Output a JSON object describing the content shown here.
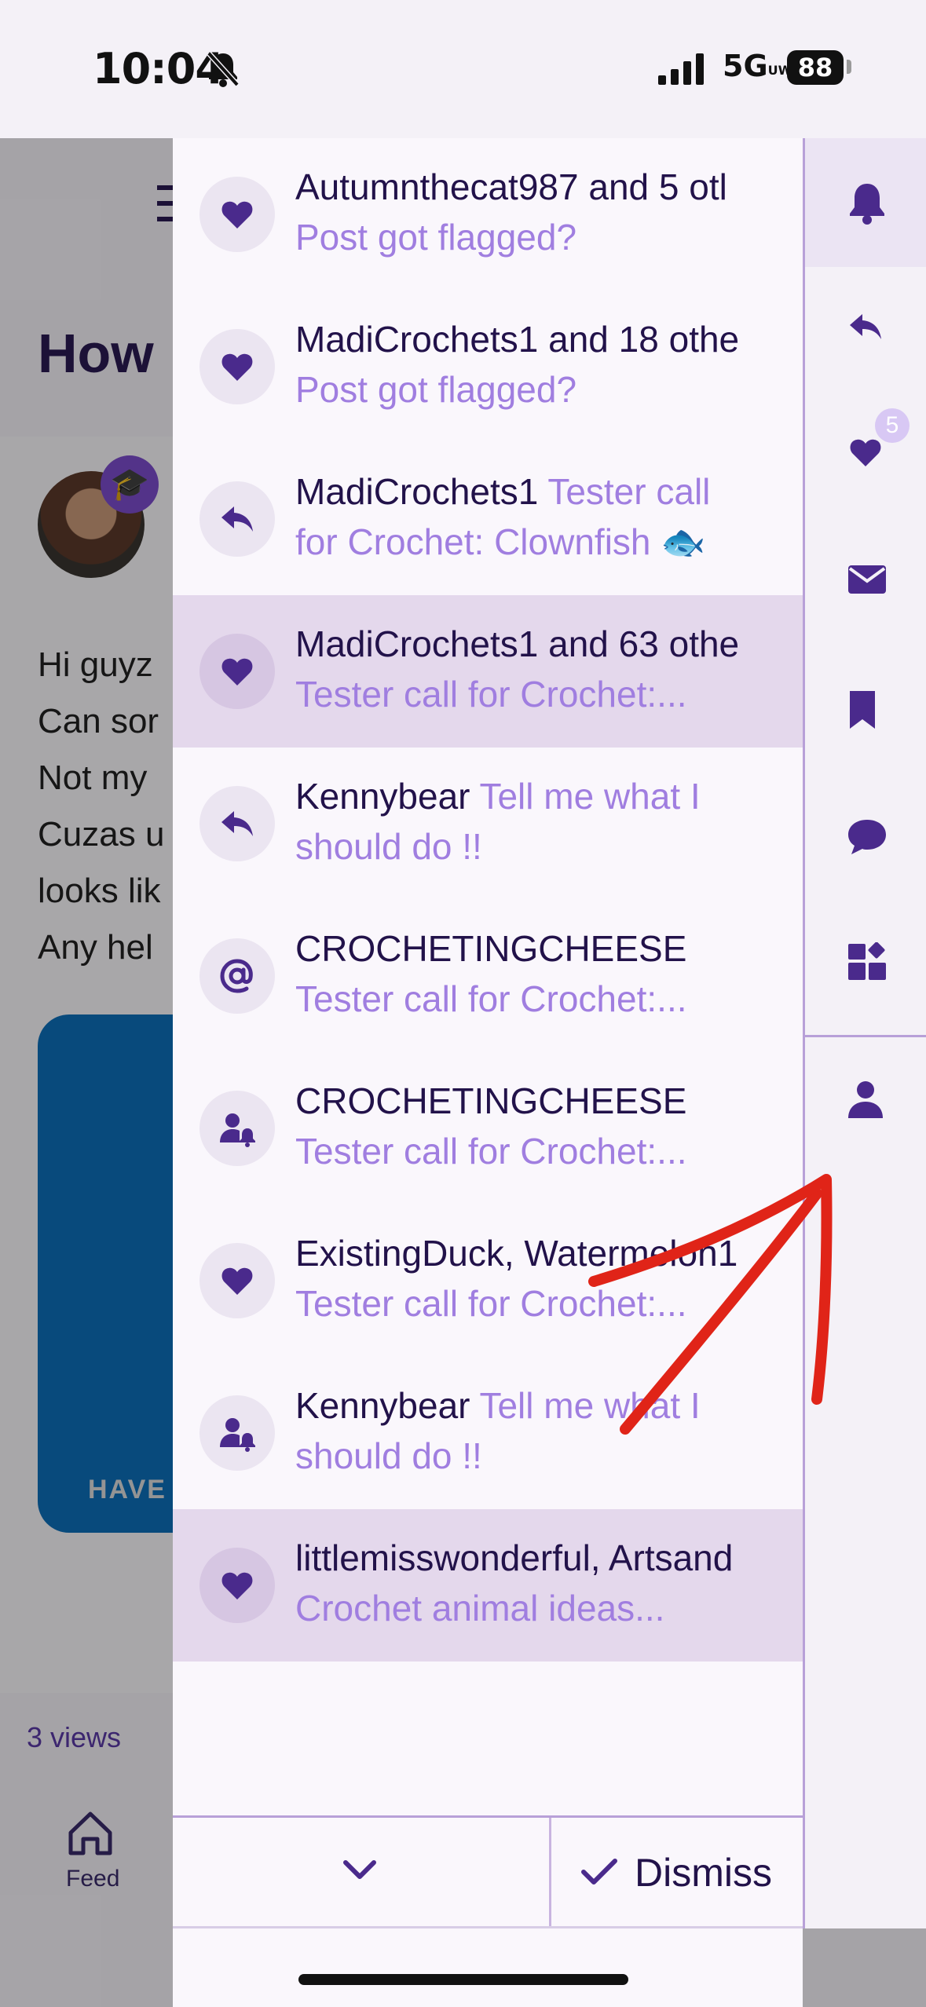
{
  "status_bar": {
    "time": "10:04",
    "network": "5G",
    "network_super": "UW",
    "battery": "88"
  },
  "background": {
    "title": "How",
    "body_lines": [
      "Hi guyz",
      "Can sor",
      "Not my",
      "Cuzas u",
      "looks lik",
      "Any hel"
    ],
    "image_text": "HAVE",
    "views": "3 views",
    "feed_label": "Feed"
  },
  "notifications": [
    {
      "icon": "heart-icon",
      "actor": "Autumnthecat987 and 5 otl",
      "subject": "",
      "subtitle": "Post got flagged?",
      "highlighted": false
    },
    {
      "icon": "heart-icon",
      "actor": "MadiCrochets1 and 18 othe",
      "subject": "",
      "subtitle": "Post got flagged?",
      "highlighted": false
    },
    {
      "icon": "reply-icon",
      "actor": "MadiCrochets1",
      "subject": "Tester call",
      "subtitle": "for Crochet: Clownfish 🐟",
      "highlighted": false
    },
    {
      "icon": "heart-icon",
      "actor": "MadiCrochets1 and 63 othe",
      "subject": "",
      "subtitle": "Tester call for Crochet:...",
      "highlighted": true
    },
    {
      "icon": "reply-icon",
      "actor": "Kennybear",
      "subject": "Tell me what I",
      "subtitle": "should do !!",
      "highlighted": false
    },
    {
      "icon": "at-icon",
      "actor": "CROCHETINGCHEESE",
      "subject": "",
      "subtitle": "Tester call for Crochet:...",
      "highlighted": false
    },
    {
      "icon": "user-bell-icon",
      "actor": "CROCHETINGCHEESE",
      "subject": "",
      "subtitle": "Tester call for Crochet:...",
      "highlighted": false
    },
    {
      "icon": "heart-icon",
      "actor": "ExistingDuck, Watermelon1",
      "subject": "",
      "subtitle": "Tester call for Crochet:...",
      "highlighted": false
    },
    {
      "icon": "user-bell-icon",
      "actor": "Kennybear",
      "subject": "Tell me what I",
      "subtitle": "should do !!",
      "highlighted": false
    },
    {
      "icon": "heart-icon",
      "actor": "littlemisswonderful, Artsand",
      "subject": "",
      "subtitle": "Crochet animal ideas...",
      "highlighted": true
    }
  ],
  "footer": {
    "dismiss_label": "Dismiss"
  },
  "rail": {
    "items": [
      {
        "icon": "bell-icon",
        "active": true
      },
      {
        "icon": "reply-icon",
        "active": false
      },
      {
        "icon": "heart-icon",
        "active": false,
        "badge": "5"
      },
      {
        "icon": "envelope-icon",
        "active": false
      },
      {
        "icon": "bookmark-icon",
        "active": false
      },
      {
        "icon": "chat-bubble-icon",
        "active": false
      },
      {
        "icon": "widgets-icon",
        "active": false
      },
      {
        "icon": "user-icon",
        "active": false
      }
    ]
  },
  "colors": {
    "accent": "#4a2a8c",
    "subtitle": "#a07ee0",
    "highlight_row": "#e4d8ec",
    "annotation": "#e02418"
  }
}
